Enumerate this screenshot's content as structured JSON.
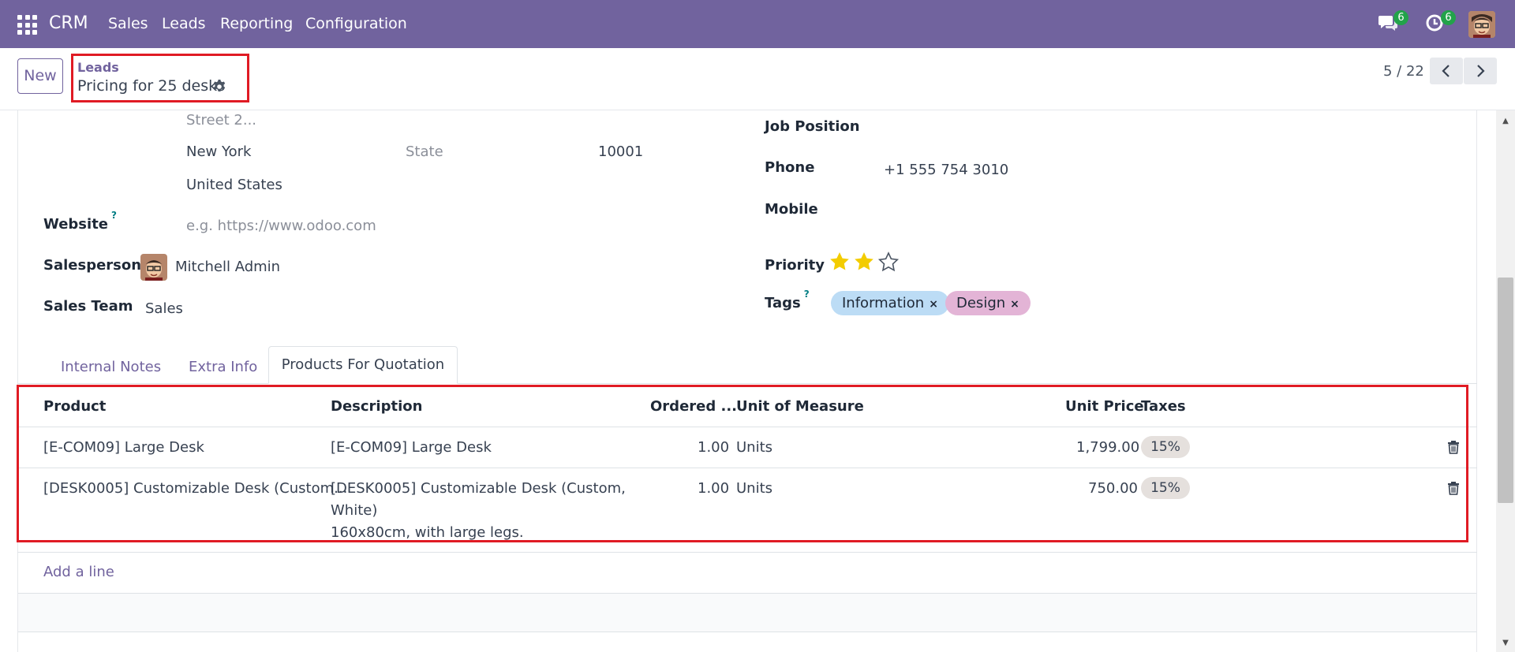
{
  "topbar": {
    "app_name": "CRM",
    "menu": [
      "Sales",
      "Leads",
      "Reporting",
      "Configuration"
    ],
    "messages_count": "6",
    "activities_count": "6",
    "icons": [
      "apps-grid-icon",
      "chat-icon",
      "clock-icon",
      "user-avatar"
    ]
  },
  "control": {
    "new_label": "New",
    "breadcrumb_parent": "Leads",
    "record_title": "Pricing for 25 desks",
    "pager": "5 / 22"
  },
  "form": {
    "street2_placeholder": "Street 2...",
    "city": "New York",
    "state_placeholder": "State",
    "zip": "10001",
    "country": "United States",
    "website_label": "Website",
    "website_placeholder": "e.g. https://www.odoo.com",
    "salesperson_label": "Salesperson",
    "salesperson": "Mitchell Admin",
    "sales_team_label": "Sales Team",
    "sales_team": "Sales",
    "job_position_label": "Job Position",
    "phone_label": "Phone",
    "phone": "+1 555 754 3010",
    "mobile_label": "Mobile",
    "priority_label": "Priority",
    "priority_stars": 2,
    "priority_max": 3,
    "tags_label": "Tags",
    "tags": [
      {
        "label": "Information",
        "color": "#bcdcf5"
      },
      {
        "label": "Design",
        "color": "#e3b4d6"
      }
    ],
    "help_mark": "?"
  },
  "tabs": [
    "Internal Notes",
    "Extra Info",
    "Products For Quotation"
  ],
  "table": {
    "headers": [
      "Product",
      "Description",
      "Ordered ...",
      "Unit of Measure",
      "Unit Price",
      "Taxes"
    ],
    "rows": [
      {
        "product": "[E-COM09] Large Desk",
        "description": [
          "[E-COM09] Large Desk"
        ],
        "qty": "1.00",
        "uom": "Units",
        "price": "1,799.00",
        "tax": "15%"
      },
      {
        "product": "[DESK0005] Customizable Desk (Custom...",
        "description": [
          "[DESK0005] Customizable Desk (Custom,",
          "White)",
          "160x80cm, with large legs."
        ],
        "qty": "1.00",
        "uom": "Units",
        "price": "750.00",
        "tax": "15%"
      }
    ],
    "add_line": "Add a line"
  },
  "colors": {
    "brand": "#71639e",
    "highlight": "#e01b24",
    "star": "#f3cc00",
    "badge": "#22a34a"
  }
}
